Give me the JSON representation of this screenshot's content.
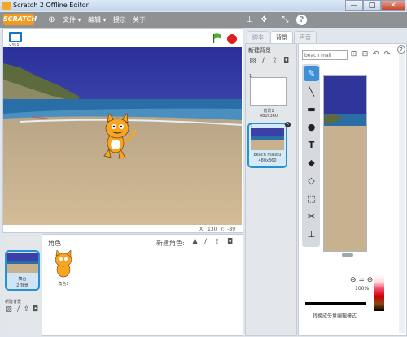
{
  "window": {
    "title": "Scratch 2 Offline Editor",
    "minimize": "—",
    "maximize": "□",
    "close": "✕"
  },
  "menubar": {
    "logo": "SCRATCH",
    "items": [
      {
        "label": "文件 ▾"
      },
      {
        "label": "编辑 ▾"
      },
      {
        "label": "提示"
      },
      {
        "label": "关于"
      }
    ],
    "globe_icon": "globe-icon",
    "tools": [
      "stamp-icon",
      "grow-icon",
      "shrink-icon",
      "help-icon"
    ]
  },
  "stage": {
    "version": "v451",
    "coords": {
      "x_label": "X: 130",
      "y_label": "Y: -89"
    }
  },
  "sprites": {
    "title": "角色",
    "new_sprite_label": "新建角色:",
    "stage_thumb_label": "舞台",
    "stage_thumb_count": "2 背景",
    "new_backdrop_label": "新建背景",
    "items": [
      {
        "name": "角色1"
      }
    ]
  },
  "tabs": [
    {
      "label": "脚本"
    },
    {
      "label": "背景"
    },
    {
      "label": "声音"
    }
  ],
  "backdrops": {
    "new_label": "新建背景",
    "items": [
      {
        "num": "1",
        "name": "背景1",
        "size": "480x360"
      },
      {
        "num": "2",
        "name": "beach malibu",
        "size": "480x360"
      }
    ]
  },
  "editor": {
    "name_value": "beach mali",
    "zoom_pct": "100%",
    "mode_label": "转换成矢量编辑模式",
    "colors": {
      "sky": "#3a40a8",
      "sand": "#c8b18e",
      "sea": "#2a6ea8",
      "accent": "#3d8fd6"
    }
  }
}
